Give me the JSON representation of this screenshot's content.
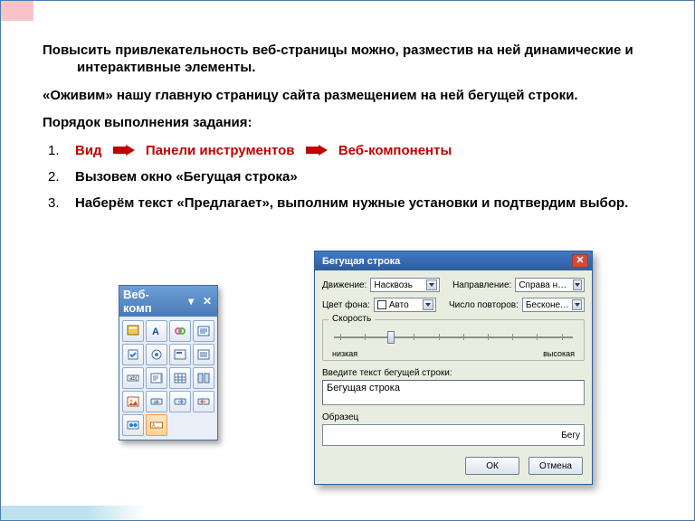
{
  "paragraphs": {
    "p1": "Повысить привлекательность веб-страницы можно, разместив на ней динамические и интерактивные элементы.",
    "p2": "«Оживим» нашу главную страницу сайта размещением на ней бегущей строки.",
    "p3": "Порядок выполнения задания:"
  },
  "steps": {
    "s1a": "Вид",
    "s1b": "Панели инструментов",
    "s1c": "Веб-компоненты",
    "s2": "Вызовем окно «Бегущая строка»",
    "s3": "Наберём текст «Предлагает», выполним нужные установки и подтвердим выбор."
  },
  "toolbar": {
    "title": "Веб-комп",
    "icons": [
      "form-icon",
      "text-icon",
      "link-icon",
      "script-icon",
      "checkbox-icon",
      "radio-icon",
      "group-icon",
      "list-icon",
      "textfield-icon",
      "textarea-icon",
      "table-icon",
      "columns-icon",
      "image-icon",
      "button-icon",
      "submit-icon",
      "reset-icon",
      "movie-icon",
      "marquee-icon",
      "",
      ""
    ]
  },
  "dialog": {
    "title": "Бегущая строка",
    "labels": {
      "movement": "Движение:",
      "direction": "Направление:",
      "bgcolor": "Цвет фона:",
      "repeat": "Число повторов:",
      "speed_group": "Скорость",
      "speed_low": "низкая",
      "speed_high": "высокая",
      "input_label": "Введите текст бегущей строки:",
      "sample_label": "Образец"
    },
    "values": {
      "movement": "Насквозь",
      "direction": "Справа налево",
      "bgcolor": "Авто",
      "repeat": "Бесконечно",
      "input_text": "Бегущая строка",
      "sample_text": "Бегу"
    },
    "buttons": {
      "ok": "ОК",
      "cancel": "Отмена"
    }
  }
}
